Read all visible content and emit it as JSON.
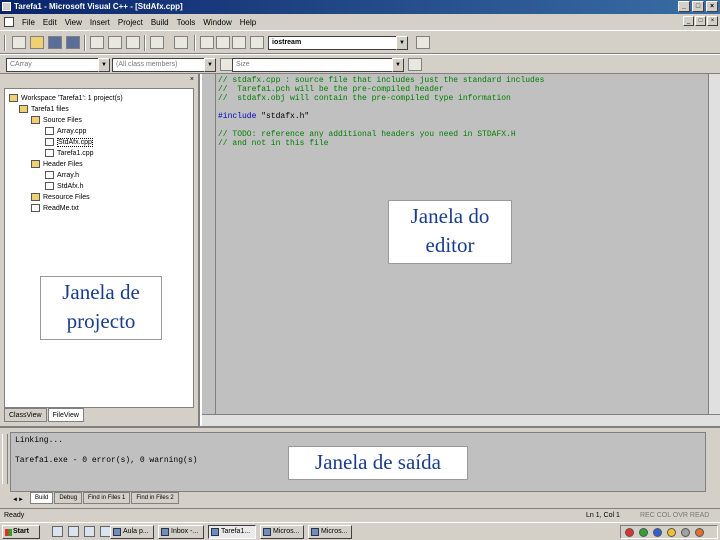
{
  "window": {
    "title": "Tarefa1 - Microsoft Visual C++ - [StdAfx.cpp]",
    "minimize": "_",
    "maximize": "□",
    "close": "×"
  },
  "menu": {
    "items": [
      "File",
      "Edit",
      "View",
      "Insert",
      "Project",
      "Build",
      "Tools",
      "Window",
      "Help"
    ]
  },
  "toolbar": {
    "find_combo": "iostream",
    "class_combo": "CArray",
    "members_combo": "(All class members)",
    "function_combo": "Size"
  },
  "workspace": {
    "tree": [
      {
        "label": "Workspace 'Tarefa1': 1 project(s)",
        "type": "root"
      },
      {
        "label": "Tarefa1 files",
        "type": "folder"
      },
      {
        "label": "Source Files",
        "type": "folder"
      },
      {
        "label": "Array.cpp",
        "type": "file"
      },
      {
        "label": "StdAfx.cpp",
        "type": "file"
      },
      {
        "label": "Tarefa1.cpp",
        "type": "file"
      },
      {
        "label": "Header Files",
        "type": "folder"
      },
      {
        "label": "Array.h",
        "type": "file"
      },
      {
        "label": "StdAfx.h",
        "type": "file"
      },
      {
        "label": "Resource Files",
        "type": "folder"
      },
      {
        "label": "ReadMe.txt",
        "type": "file"
      }
    ],
    "tabs": [
      "ClassView",
      "FileView"
    ],
    "active_tab": "FileView"
  },
  "editor": {
    "lines": [
      {
        "text": "// stdafx.cpp : source file that includes just the standard includes",
        "kind": "comment"
      },
      {
        "text": "//  Tarefa1.pch will be the pre-compiled header",
        "kind": "comment"
      },
      {
        "text": "//  stdafx.obj will contain the pre-compiled type information",
        "kind": "comment"
      },
      {
        "text": "",
        "kind": "blank"
      },
      {
        "text": "#include \"stdafx.h\"",
        "kind": "directive"
      },
      {
        "text": "",
        "kind": "blank"
      },
      {
        "text": "// TODO: reference any additional headers you need in STDAFX.H",
        "kind": "comment"
      },
      {
        "text": "// and not in this file",
        "kind": "comment"
      }
    ]
  },
  "labels": {
    "editor": [
      "Janela do",
      "editor"
    ],
    "project": [
      "Janela de",
      "projecto"
    ],
    "output": "Janela de saída"
  },
  "output": {
    "lines": [
      "Linking...",
      "",
      "Tarefa1.exe - 0 error(s), 0 warning(s)"
    ],
    "tabs": [
      "Build",
      "Debug",
      "Find in Files 1",
      "Find in Files 2"
    ],
    "active_tab": "Build"
  },
  "statusbar": {
    "left": "Ready",
    "position": "Ln 1, Col 1",
    "flags": "REC  COL  OVR  READ"
  },
  "taskbar": {
    "start": "Start",
    "tasks": [
      "Aula p...",
      "Inbox -...",
      "Tarefa1...",
      "Micros...",
      "Micros..."
    ],
    "active_task": 2
  }
}
